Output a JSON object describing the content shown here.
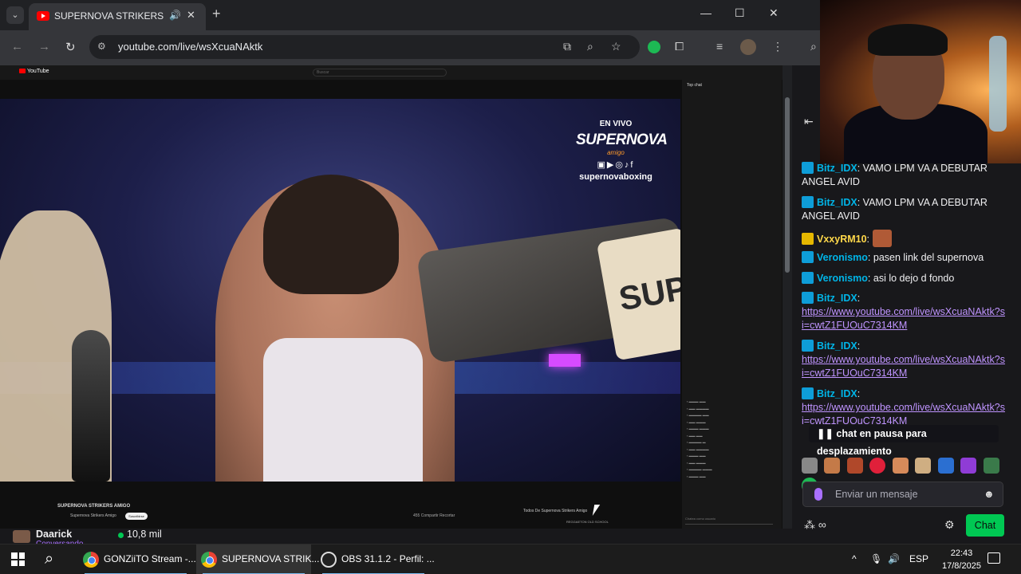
{
  "browser": {
    "tab_title": "SUPERNOVA STRIKERS AMIG",
    "url": "youtube.com/live/wsXcuaNAktk"
  },
  "youtube": {
    "logo": "YouTube",
    "search_placeholder": "Buscar",
    "chat_header": "Top chat",
    "chat_input": "Chatea como usuario",
    "below": {
      "title": "SUPERNOVA STRIKERS AMIGO",
      "channel": "Supernova Strikers Amigo",
      "subscribe": "Suscribirse",
      "actions": "455    Compartir    Recortar",
      "chips": "Todos    De Supernova Strikers Amigo",
      "rec_title": "REGGAETON OLD SCHOOL"
    }
  },
  "overlay": {
    "live": "EN VIVO",
    "brand": "SUPERNOVA",
    "amigo": "amigo",
    "socials": "▣▶◎♪f",
    "handle": "supernovaboxing",
    "belt_text": "SUP"
  },
  "stream_chat": {
    "messages": [
      {
        "user": "Bitz_IDX",
        "text": "VAMO LPM VA A DEBUTAR ANGEL AVID",
        "type": "text"
      },
      {
        "user": "Bitz_IDX",
        "text": "VAMO LPM VA A DEBUTAR ANGEL AVID",
        "type": "text"
      },
      {
        "user": "VxxyRM10",
        "text": "",
        "type": "emote"
      },
      {
        "user": "Veronismo",
        "text": "pasen link del supernova",
        "type": "text"
      },
      {
        "user": "Veronismo",
        "text": "asi lo dejo d fondo",
        "type": "text"
      },
      {
        "user": "Bitz_IDX",
        "text": "https://www.youtube.com/live/wsXcuaNAktk?si=cwtZ1FUOuC7314KM",
        "type": "link"
      },
      {
        "user": "Bitz_IDX",
        "text": "https://www.youtube.com/live/wsXcuaNAktk?si=cwtZ1FUOuC7314KM",
        "type": "link"
      },
      {
        "user": "Bitz_IDX",
        "text": "https://www.youtube.com/live/wsXcuaNAktk?si=cwtZ1FUOuC7314KM",
        "type": "link"
      }
    ],
    "pause_banner": "chat en pausa para desplazamiento",
    "input_placeholder": "Enviar un mensaje",
    "chat_button": "Chat",
    "points_symbol": "∞"
  },
  "streamer": {
    "name": "Daarick",
    "viewers": "10,8 mil",
    "category": "Conversando"
  },
  "taskbar": {
    "items": [
      {
        "label": "GONZiiTO Stream -...",
        "icon": "chrome"
      },
      {
        "label": "SUPERNOVA STRIK...",
        "icon": "chrome"
      },
      {
        "label": "OBS 31.1.2 - Perfil: ...",
        "icon": "obs"
      }
    ],
    "lang": "ESP",
    "time": "22:43",
    "date": "17/8/2025"
  },
  "colors": {
    "twitch_purple": "#a970ff",
    "chat_button": "#00c853",
    "youtube_red": "#ff0000"
  }
}
